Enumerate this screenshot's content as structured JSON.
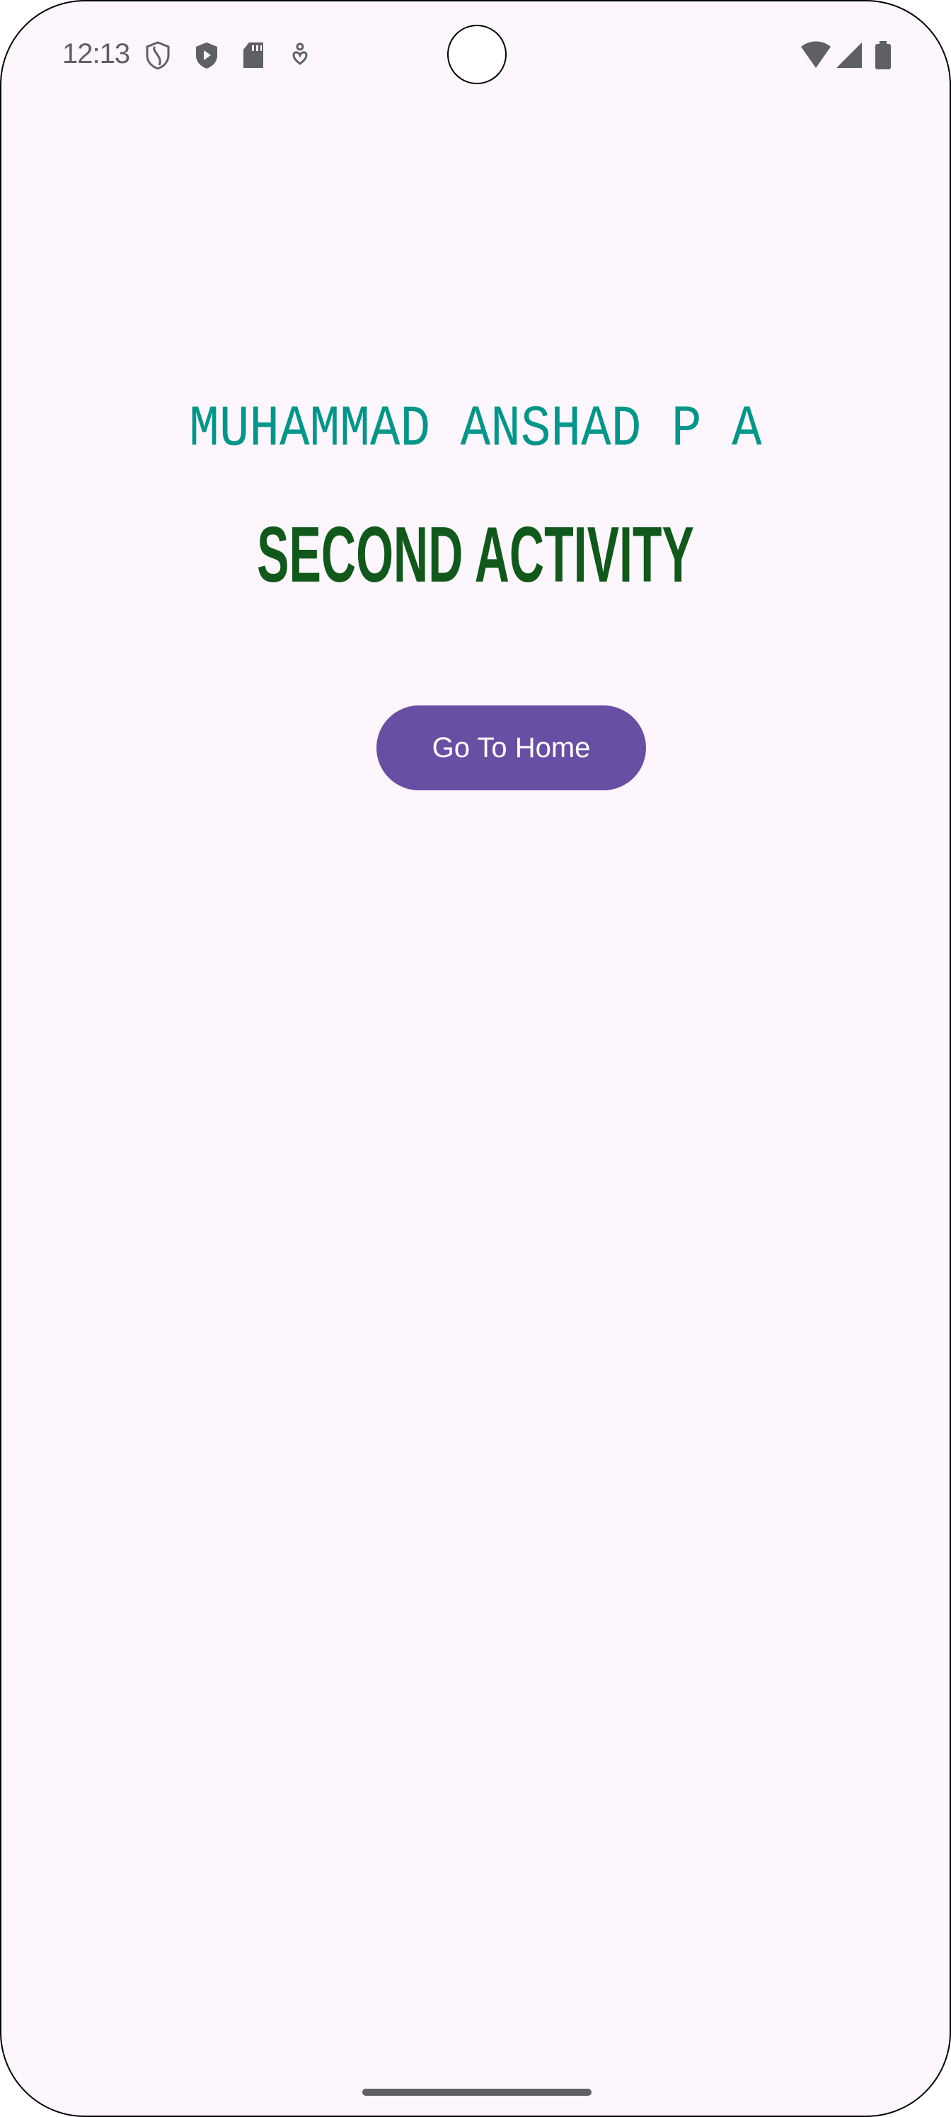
{
  "status_bar": {
    "time": "12:13",
    "left_icons": [
      "shield-icon",
      "play-protect-icon",
      "sd-card-icon",
      "accessibility-icon"
    ],
    "right_icons": [
      "wifi-icon",
      "signal-icon",
      "battery-icon"
    ]
  },
  "main": {
    "name": "MUHAMMAD ANSHAD P A",
    "title": "SECOND ACTIVITY",
    "button_label": "Go To Home"
  },
  "colors": {
    "background": "#fdf6fd",
    "name": "#00968a",
    "title": "#10591a",
    "button": "#6750a4"
  }
}
